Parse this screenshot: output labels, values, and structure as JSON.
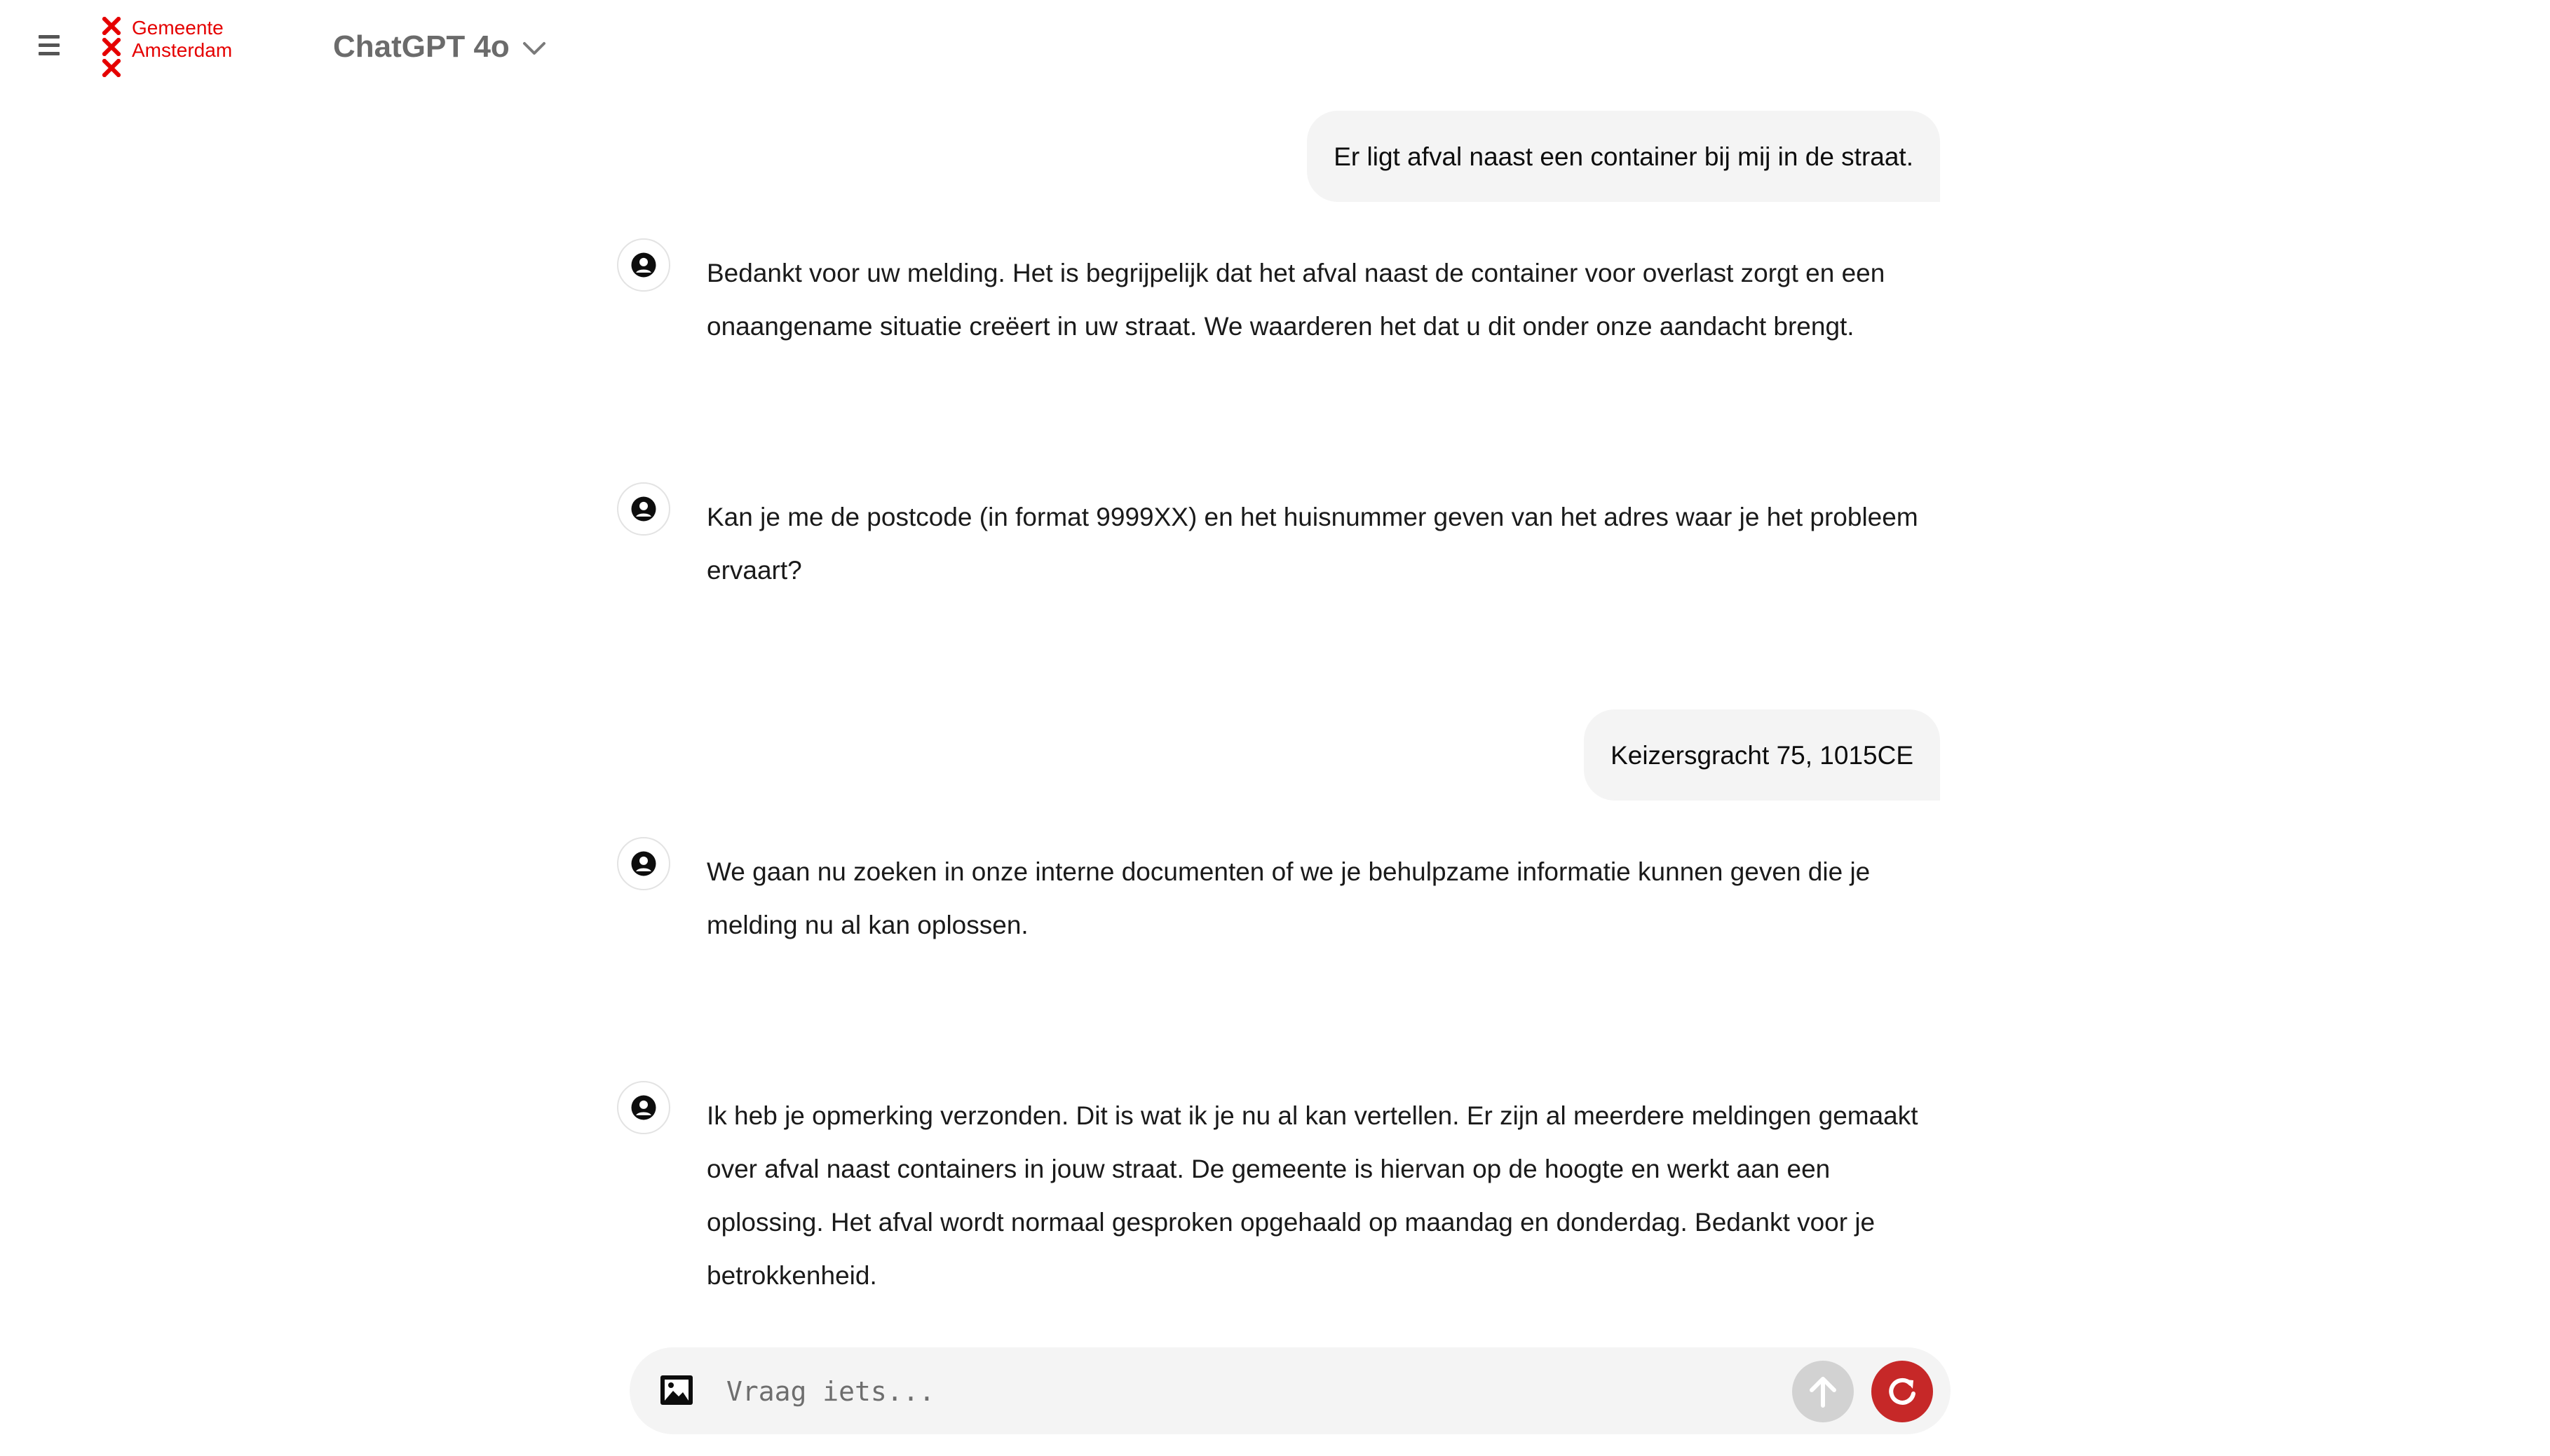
{
  "header": {
    "logo_line1": "Gemeente",
    "logo_line2": "Amsterdam",
    "model_name": "ChatGPT 4o"
  },
  "icons": {
    "menu": "hamburger-icon",
    "logo_mark": "x-crosses-icon",
    "model_dropdown": "chevron-down-icon",
    "assistant": "user-circle-icon",
    "attach": "image-icon",
    "send": "arrow-up-icon",
    "reset": "refresh-icon"
  },
  "colors": {
    "brand_red": "#e50000",
    "reset_button": "#c62828",
    "send_button_disabled": "#d2d2d2",
    "bubble_bg": "#f4f4f4"
  },
  "messages": [
    {
      "role": "user",
      "text": "Er ligt afval naast een container bij mij in de straat."
    },
    {
      "role": "assistant",
      "text": "Bedankt voor uw melding. Het is begrijpelijk dat het afval naast de container voor overlast zorgt en een onaangename situatie creëert in uw straat. We waarderen het dat u dit onder onze aandacht brengt."
    },
    {
      "role": "assistant",
      "text": "Kan je me de postcode (in format 9999XX) en het huisnummer geven van het adres waar je het probleem ervaart?"
    },
    {
      "role": "user",
      "text": "Keizersgracht 75, 1015CE"
    },
    {
      "role": "assistant",
      "text": "We gaan nu zoeken in onze interne documenten of we je behulpzame informatie kunnen geven die je melding nu al kan oplossen."
    },
    {
      "role": "assistant",
      "text": "Ik heb je opmerking verzonden. Dit is wat ik je nu al kan vertellen. Er zijn al meerdere meldingen gemaakt over afval naast containers in jouw straat. De gemeente is hiervan op de hoogte en werkt aan een oplossing. Het afval wordt normaal gesproken opgehaald op maandag en donderdag. Bedankt voor je betrokkenheid."
    }
  ],
  "composer": {
    "placeholder": "Vraag iets...",
    "value": ""
  }
}
